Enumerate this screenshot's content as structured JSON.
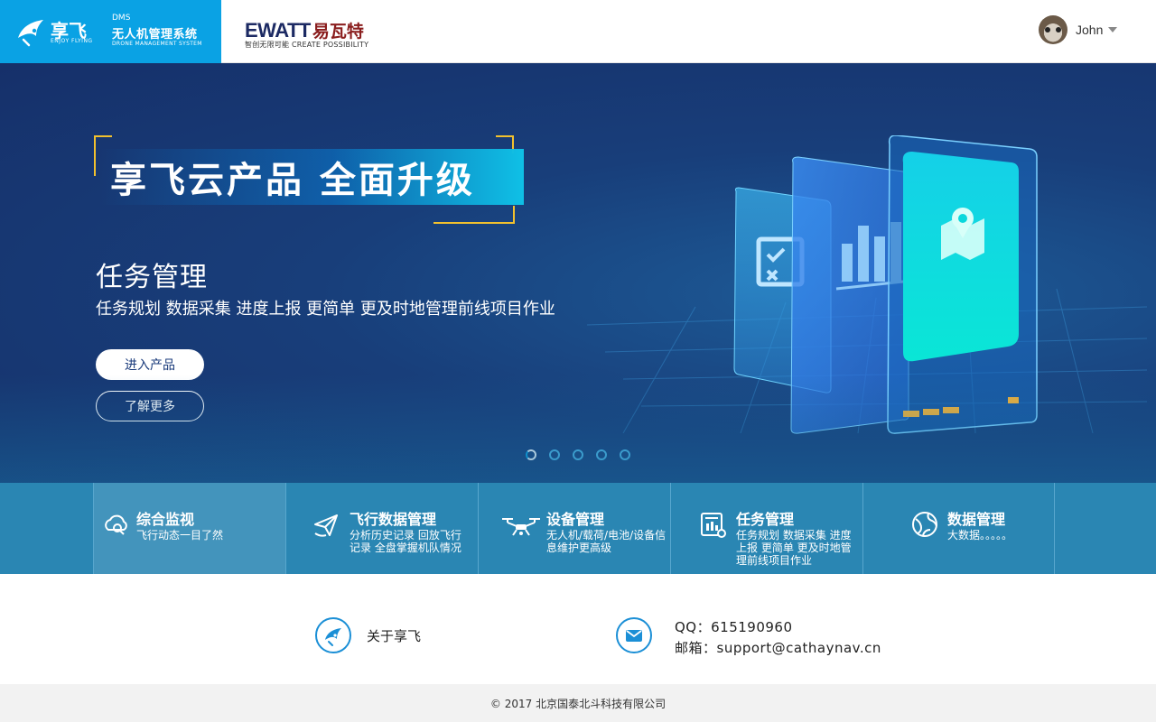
{
  "header": {
    "brand_name": "享飞",
    "brand_en": "ENJOY FLYING",
    "dms_tag": "DMS",
    "system_name": "无人机管理系统",
    "system_en": "DRONE MANAGEMENT SYSTEM",
    "partner_en": "EWATT",
    "partner_cn": "易瓦特",
    "partner_slogan": "智创无限可能 CREATE POSSIBILITY",
    "user_name": "John"
  },
  "hero": {
    "title": "享飞云产品 全面升级",
    "subtitle": "任务管理",
    "description": "任务规划  数据采集  进度上报  更简单  更及时地管理前线项目作业",
    "primary_button": "进入产品",
    "secondary_button": "了解更多",
    "slides_total": 5,
    "active_slide": 1
  },
  "features": [
    {
      "title": "综合监视",
      "desc": "飞行动态一目了然",
      "icon": "cloud-monitor-icon"
    },
    {
      "title": "飞行数据管理",
      "desc": "分析历史记录 回放飞行记录 全盘掌握机队情况",
      "icon": "paper-plane-icon"
    },
    {
      "title": "设备管理",
      "desc": "无人机/载荷/电池/设备信息维护更高级",
      "icon": "drone-icon"
    },
    {
      "title": "任务管理",
      "desc": "任务规划 数据采集 进度上报 更简单 更及时地管理前线项目作业",
      "icon": "task-chart-icon"
    },
    {
      "title": "数据管理",
      "desc": "大数据。。。。。",
      "icon": "globe-icon"
    }
  ],
  "contact": {
    "about_label": "关于享飞",
    "qq": "QQ：615190960",
    "email": "邮箱：support@cathaynav.cn"
  },
  "footer": {
    "copyright": "©  2017 北京国泰北斗科技有限公司"
  },
  "colors": {
    "brand_blue": "#0aa2e4",
    "hero_dark": "#16306a",
    "feature_bar": "#2a86b3",
    "accent_gold": "#f2c12e"
  }
}
